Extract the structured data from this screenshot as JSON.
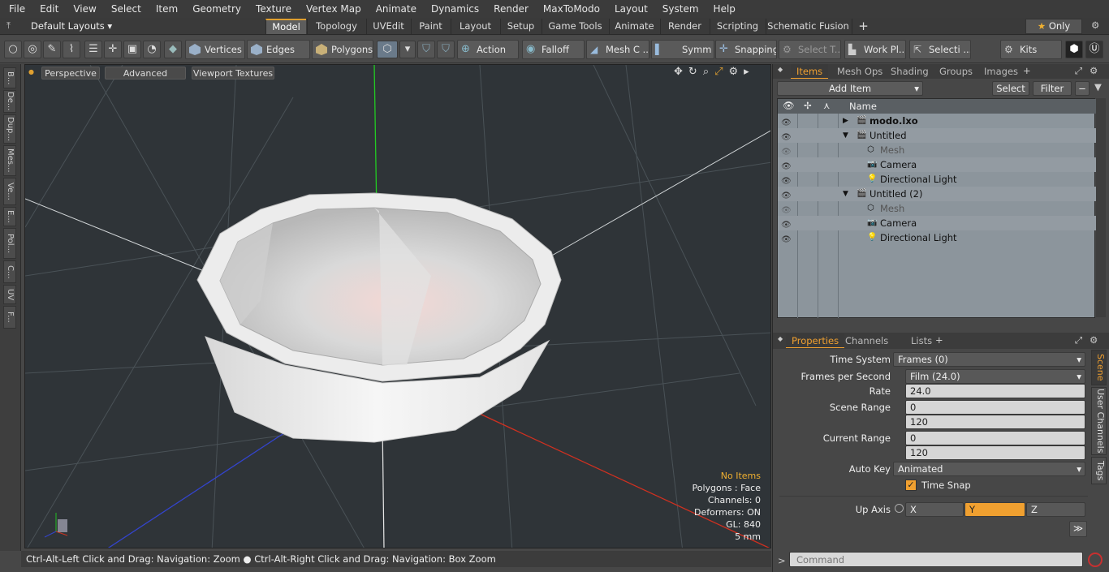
{
  "menu": [
    "File",
    "Edit",
    "View",
    "Select",
    "Item",
    "Geometry",
    "Texture",
    "Vertex Map",
    "Animate",
    "Dynamics",
    "Render",
    "MaxToModo",
    "Layout",
    "System",
    "Help"
  ],
  "layouts": {
    "label": "Default Layouts",
    "only": "Only"
  },
  "layout_tabs": [
    "Model",
    "Topology",
    "UVEdit",
    "Paint",
    "Layout",
    "Setup",
    "Game Tools",
    "Animate",
    "Render",
    "Scripting",
    "Schematic Fusion"
  ],
  "toolbar": {
    "vertices": "Vertices",
    "edges": "Edges",
    "polygons": "Polygons",
    "action": "Action",
    "falloff": "Falloff",
    "mesh": "Mesh C ...",
    "symm": "Symm ...",
    "snapping": "Snapping",
    "select_t": "Select T...",
    "workpl": "Work Pl...",
    "selecti": "Selecti ...",
    "kits": "Kits"
  },
  "left_tabs": [
    "B...",
    "De...",
    "Dup...",
    "Mes...",
    "Ve...",
    "E...",
    "Pol...",
    "C...",
    "UV",
    "F..."
  ],
  "viewport": {
    "perspective": "Perspective",
    "advanced": "Advanced",
    "textures": "Viewport Textures",
    "no_items": "No Items",
    "polygons": "Polygons : Face",
    "channels": "Channels: 0",
    "deformers": "Deformers: ON",
    "gl": "GL: 840",
    "scale": "5 mm"
  },
  "status": "Ctrl-Alt-Left Click and Drag: Navigation: Zoom ● Ctrl-Alt-Right Click and Drag: Navigation: Box Zoom",
  "items_tabs": [
    "Items",
    "Mesh Ops",
    "Shading",
    "Groups",
    "Images"
  ],
  "items_bar": {
    "add": "Add Item",
    "select": "Select",
    "filter": "Filter",
    "name_col": "Name"
  },
  "tree": [
    {
      "label": "modo.lxo",
      "level": 0,
      "bold": true
    },
    {
      "label": "Untitled",
      "level": 0
    },
    {
      "label": "Mesh",
      "level": 1,
      "dim": true
    },
    {
      "label": "Camera",
      "level": 1
    },
    {
      "label": "Directional Light",
      "level": 1
    },
    {
      "label": "Untitled (2)",
      "level": 0
    },
    {
      "label": "Mesh",
      "level": 1,
      "dim": true
    },
    {
      "label": "Camera",
      "level": 1
    },
    {
      "label": "Directional Light",
      "level": 1
    }
  ],
  "props_tabs": [
    "Properties",
    "Channels",
    "Lists"
  ],
  "props": {
    "time_system": {
      "label": "Time System",
      "value": "Frames (0)"
    },
    "fps": {
      "label": "Frames per Second",
      "value": "Film (24.0)"
    },
    "rate": {
      "label": "Rate",
      "value": "24.0"
    },
    "scene_range": {
      "label": "Scene Range",
      "start": "0",
      "end": "120"
    },
    "current_range": {
      "label": "Current Range",
      "start": "0",
      "end": "120"
    },
    "auto_key": {
      "label": "Auto Key",
      "value": "Animated"
    },
    "time_snap": "Time Snap",
    "up_axis": {
      "label": "Up Axis",
      "x": "X",
      "y": "Y",
      "z": "Z"
    }
  },
  "side_tabs": [
    "Scene",
    "User Channels",
    "Tags"
  ],
  "command_placeholder": "Command"
}
